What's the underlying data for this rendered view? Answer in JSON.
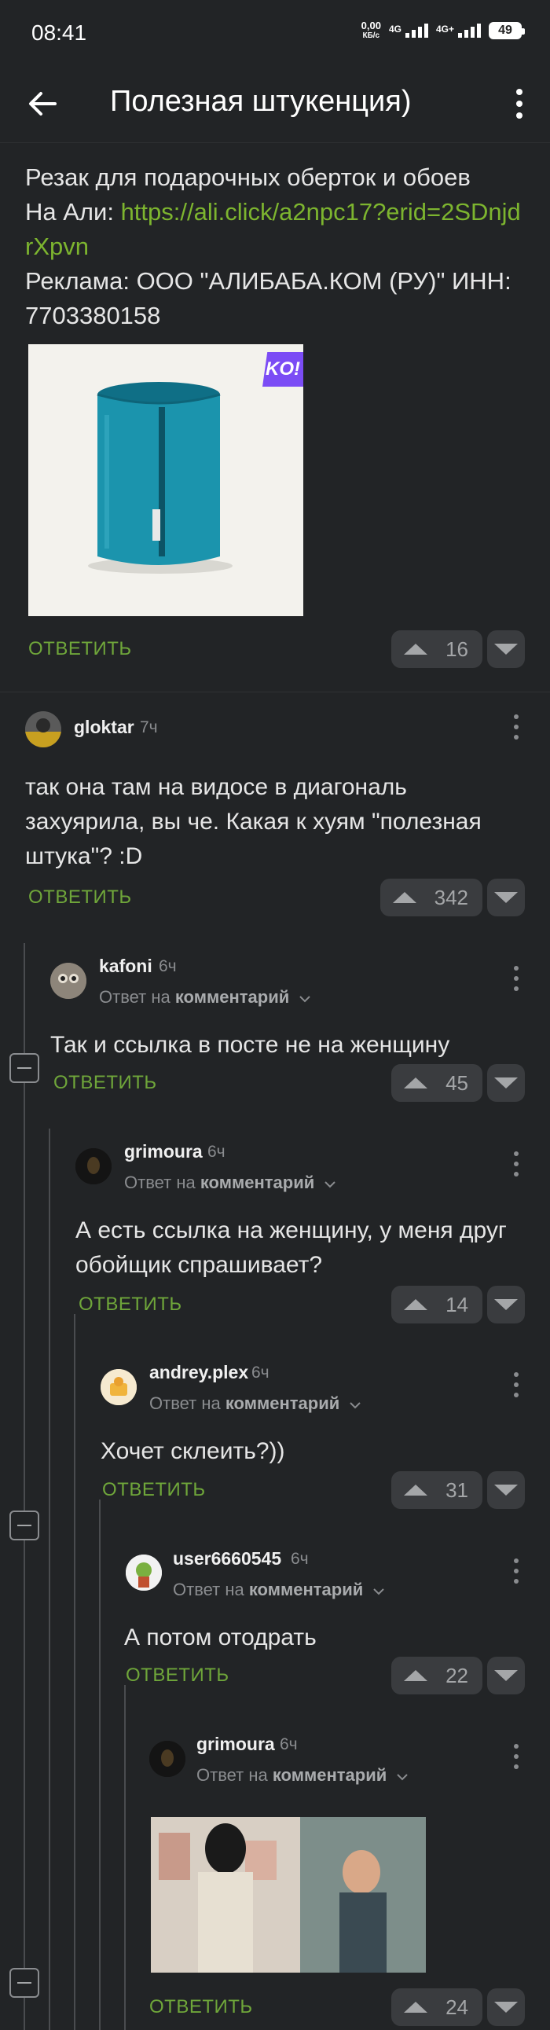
{
  "status": {
    "time": "08:41",
    "speed_value": "0,00",
    "speed_unit": "КБ/с",
    "net1": "4G",
    "net2": "4G+",
    "battery": "49"
  },
  "appbar": {
    "title": "Полезная штукенция)"
  },
  "post": {
    "line1": "Резак для подарочных оберток и обоев",
    "ali_prefix": "На Али: ",
    "link": "https://ali.click/a2npc17?erid=2SDnjdrXpvn",
    "ad": "Реклама: ООО \"АЛИБАБА.КОМ (РУ)\" ИНН: 7703380158",
    "badge": "KO!",
    "reply_label": "ОТВЕТИТЬ",
    "votes": "16"
  },
  "comments": [
    {
      "user": "gloktar",
      "time": "7ч",
      "reply_to_prefix": "",
      "reply_to_link": "",
      "text": "так она там на видосе в диагональ захуярила, вы че. Какая к хуям \"полезная штука\"? :D",
      "reply_label": "ОТВЕТИТЬ",
      "votes": "342"
    },
    {
      "user": "kafoni",
      "time": "6ч",
      "reply_to_prefix": "Ответ на ",
      "reply_to_link": "комментарий",
      "text": "Так и ссылка в посте не на женщину",
      "reply_label": "ОТВЕТИТЬ",
      "votes": "45"
    },
    {
      "user": "grimoura",
      "time": "6ч",
      "reply_to_prefix": "Ответ на ",
      "reply_to_link": "комментарий",
      "text": "А есть ссылка на женщину, у меня друг обойщик спрашивает?",
      "reply_label": "ОТВЕТИТЬ",
      "votes": "14"
    },
    {
      "user": "andrey.plex",
      "time": "6ч",
      "reply_to_prefix": "Ответ на ",
      "reply_to_link": "комментарий",
      "text": "Хочет склеить?))",
      "reply_label": "ОТВЕТИТЬ",
      "votes": "31"
    },
    {
      "user": "user6660545",
      "time": "6ч",
      "reply_to_prefix": "Ответ на ",
      "reply_to_link": "комментарий",
      "text": "А потом отодрать",
      "reply_label": "ОТВЕТИТЬ",
      "votes": "22"
    },
    {
      "user": "grimoura",
      "time": "6ч",
      "reply_to_prefix": "Ответ на ",
      "reply_to_link": "комментарий",
      "text": "",
      "reply_label": "ОТВЕТИТЬ",
      "votes": "24"
    }
  ],
  "colors": {
    "background": "#222426",
    "link": "#7db52f",
    "reply": "#6fa63a",
    "vote_bg": "#3a3c3f"
  },
  "icons": [
    "back-arrow-icon",
    "more-vertical-icon",
    "upvote-icon",
    "downvote-icon",
    "collapse-thread-icon",
    "chevron-down-icon"
  ]
}
